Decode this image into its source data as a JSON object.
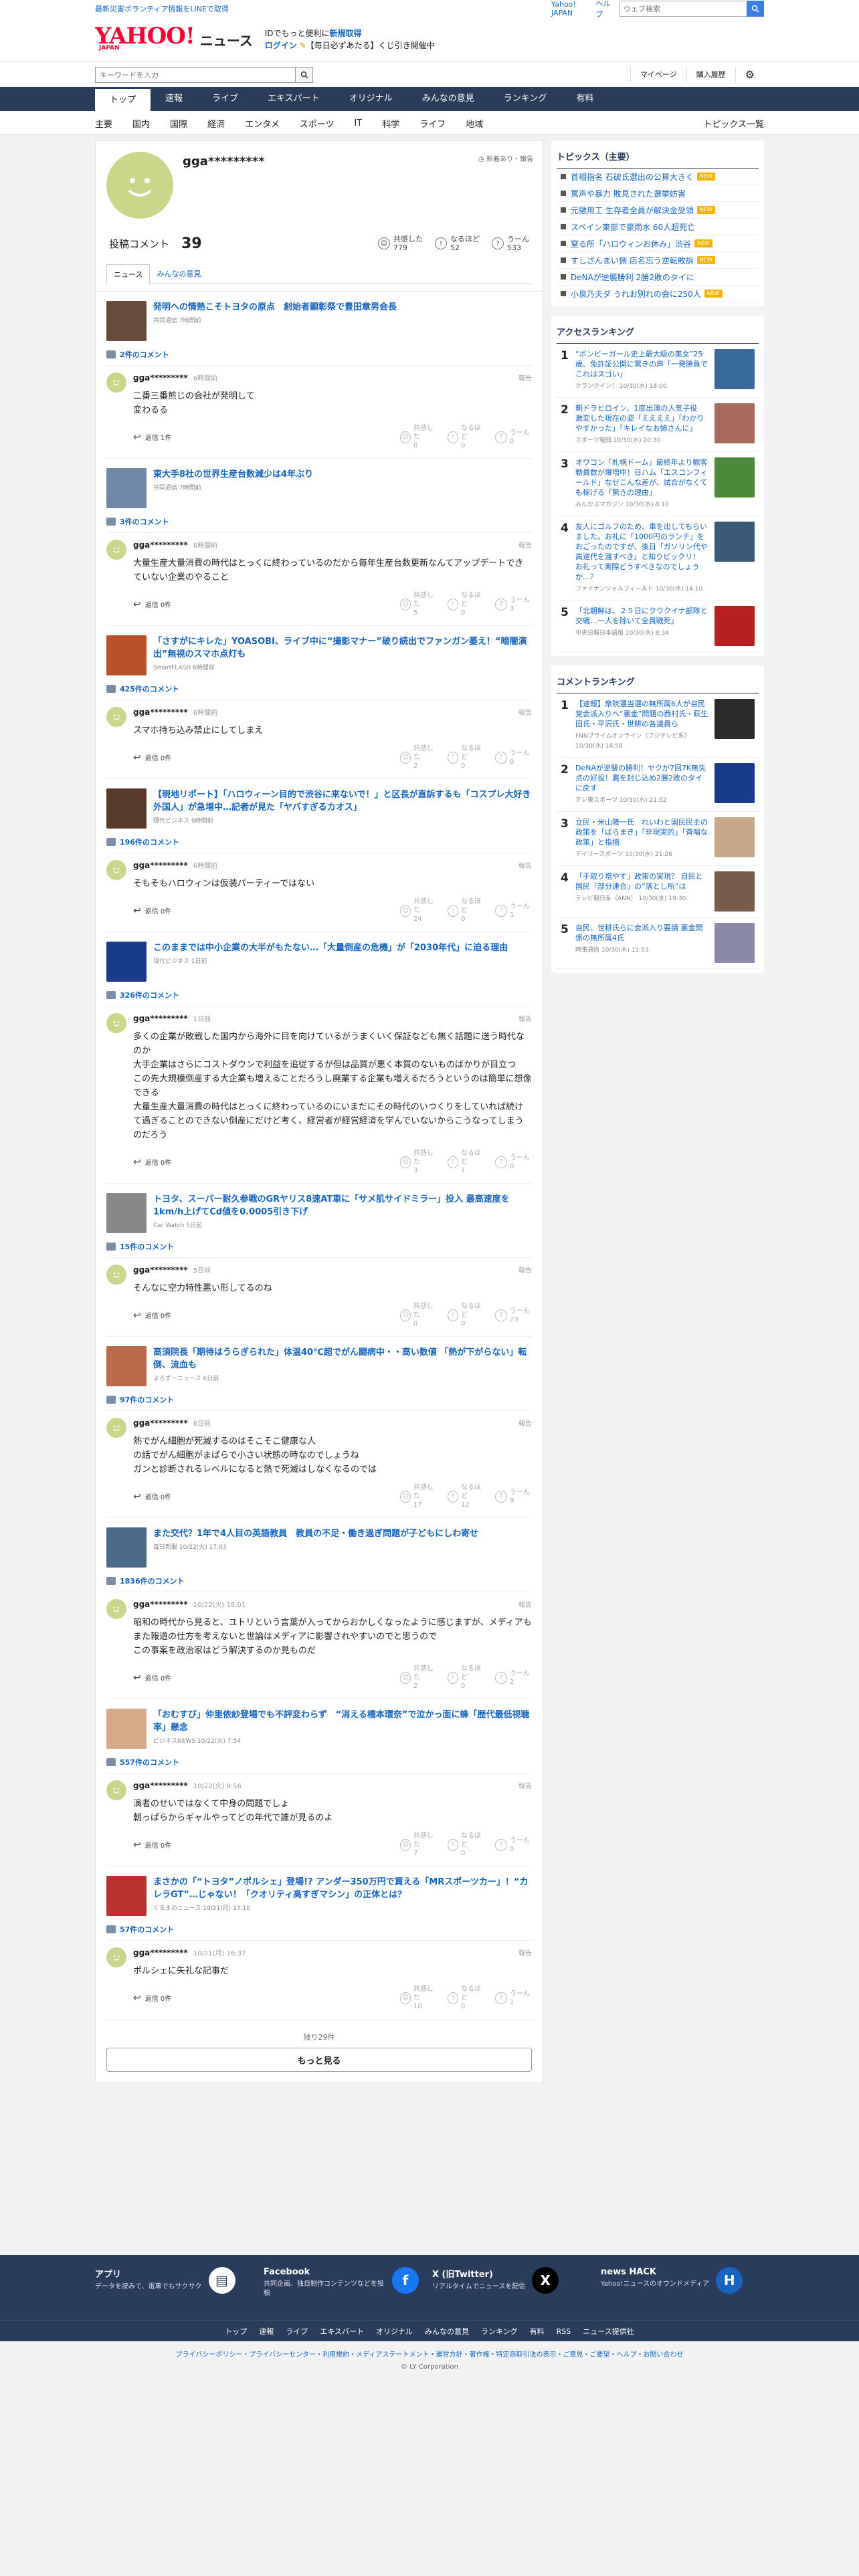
{
  "topline": {
    "notice": "最新災害ボランティア情報をLINEで取得",
    "yahoo_japan": "Yahoo! JAPAN",
    "help": "ヘルプ",
    "web_search_placeholder": "ウェブ検索"
  },
  "header": {
    "logo": "YAHOO!",
    "logo_sub": "JAPAN",
    "site": "ニュース",
    "promo_line1": "IDでもっと便利に",
    "promo_new": "新規取得",
    "promo_login": "ログイン",
    "promo_line2": "【毎日必ずあたる】くじ引き開催中"
  },
  "search": {
    "placeholder": "キーワードを入力",
    "mypage": "マイページ",
    "history": "購入履歴"
  },
  "nav": [
    "トップ",
    "速報",
    "ライブ",
    "エキスパート",
    "オリジナル",
    "みんなの意見",
    "ランキング",
    "有料"
  ],
  "categories": [
    "主要",
    "国内",
    "国際",
    "経済",
    "エンタメ",
    "スポーツ",
    "IT",
    "科学",
    "ライフ",
    "地域"
  ],
  "categories_all": "トピックス一覧",
  "profile": {
    "username": "gga*********",
    "notify": "新着あり・報告",
    "comment_label": "投稿コメント",
    "comment_count": "39",
    "stats": [
      {
        "label": "共感した",
        "value": "779"
      },
      {
        "label": "なるほど",
        "value": "52"
      },
      {
        "label": "うーん",
        "value": "533"
      }
    ],
    "tabs": [
      "ニュース",
      "みんなの意見"
    ]
  },
  "reaction_labels": [
    "共感した",
    "なるほど",
    "うーん"
  ],
  "reply_label": "返信 0件",
  "report_label": "報告",
  "colors": {
    "nav": "#2a3c5c",
    "link": "#1565c0",
    "avatar": "#c9d78a"
  },
  "feed": [
    {
      "title": "発明への情熱こそトヨタの原点　創始者顕彰祭で豊田章男会長",
      "source": "共同通信 7時間前",
      "count": "2件のコメント",
      "user": "gga*********",
      "time": "6時間前",
      "text": "二番三番煎じの会社が発明して\n変わるる",
      "reacts": [
        "0",
        "0",
        "0"
      ],
      "reply": "返信 1件"
    },
    {
      "title": "東大手8社の世界生産台数減少は4年ぶり",
      "source": "共同通信 7時間前",
      "count": "3件のコメント",
      "user": "gga*********",
      "time": "6時間前",
      "text": "大量生産大量消費の時代はとっくに終わっているのだから毎年生産台数更新なんてアップデートできていない企業のやること",
      "reacts": [
        "5",
        "0",
        "3"
      ],
      "reply": "返信 0件"
    },
    {
      "title": "「さすがにキレた」YOASOBI、ライブ中に“撮影マナー”破り続出でファンガン萎え！“暗闇演出”無視のスマホ点灯も",
      "source": "SmartFLASH 6時間前",
      "count": "425件のコメント",
      "user": "gga*********",
      "time": "6時間前",
      "text": "スマホ持ち込み禁止にしてしまえ",
      "reacts": [
        "2",
        "0",
        "0"
      ],
      "reply": "返信 0件"
    },
    {
      "title": "【現地リポート】「ハロウィーン目的で渋谷に来ないで！」と区長が直訴するも「コスプレ大好き外国人」が急増中…記者が見た「ヤバすぎるカオス」",
      "source": "現代ビジネス 6時間前",
      "count": "196件のコメント",
      "user": "gga*********",
      "time": "6時間前",
      "text": "そもそもハロウィンは仮装パーティーではない",
      "reacts": [
        "24",
        "0",
        "1"
      ],
      "reply": "返信 0件"
    },
    {
      "title": "このままでは中小企業の大半がもたない…「大量倒産の危機」が「2030年代」に迫る理由",
      "source": "現代ビジネス 1日前",
      "count": "326件のコメント",
      "user": "gga*********",
      "time": "1日前",
      "text": "多くの企業が敗戦した国内から海外に目を向けているがうまくいく保証なども無く話題に送う時代なのか\n大手企業はさらにコストダウンで利益を追従するが但は品質が悪く本質のないものばかりが目立つ\nこの先大規模倒産する大企業も増えることだろうし廃業する企業も増えるだろうというのは簡単に想像できる\n大量生産大量消費の時代はとっくに終わっているのにいまだにその時代のいつくりをしていれば続けて過ぎることのできない倒産にだけど考く、経営者が経営経済を学んでいないからこうなってしまうのだろう",
      "reacts": [
        "3",
        "1",
        "0"
      ],
      "reply": "返信 0件"
    },
    {
      "title": "トヨタ、スーパー耐久参戦のGRヤリス8速AT車に「サメ肌サイドミラー」投入 最高速度を1km/h上げてCd値を0.0005引き下げ",
      "source": "Car Watch 5日前",
      "count": "15件のコメント",
      "user": "gga*********",
      "time": "5日前",
      "text": "そんなに空力特性悪い形してるのね",
      "reacts": [
        "0",
        "0",
        "23"
      ],
      "reply": "返信 0件"
    },
    {
      "title": "高須院長「期待はうらぎられた」体温40℃超でがん闘病中・・高い数値 「熱が下がらない」転倒、流血も",
      "source": "よろずーニュース 6日前",
      "count": "97件のコメント",
      "user": "gga*********",
      "time": "6日前",
      "text": "熱でがん細胞が死滅するのはそこそこ健康な人\nの話でがん細胞がまばらで小さい状態の時なのでしょうね\nガンと診断されるレベルになると熱で死滅はしなくなるのでは",
      "reacts": [
        "17",
        "12",
        "9"
      ],
      "reply": "返信 0件"
    },
    {
      "title": "また交代？1年で4人目の英語教員　教員の不足・働き過ぎ問題が子どもにしわ寄せ",
      "source": "毎日新聞 10/22(火) 17:03",
      "count": "1836件のコメント",
      "user": "gga*********",
      "time": "10/22(火) 18:01",
      "text": "昭和の時代から見ると、ユトリという言葉が入ってからおかしくなったように感じますが、メディアもまた報道の仕方を考えないと世論はメディアに影響されやすいのでと思うので\nこの事案を政治家はどう解決するのか見ものだ",
      "reacts": [
        "2",
        "0",
        "2"
      ],
      "reply": "返信 0件"
    },
    {
      "title": "「おむすび」仲里依紗登場でも不評変わらず　“消える橋本環奈”で泣かっ面に蜂「歴代最低視聴率」懸念",
      "source": "ビジネスNEWS 10/22(火) 7:54",
      "count": "557件のコメント",
      "user": "gga*********",
      "time": "10/22(火) 9:56",
      "text": "演者のせいではなくて中身の問題でしょ\n朝っぱらからギャルやってどの年代で誰が見るのよ",
      "reacts": [
        "7",
        "0",
        "0"
      ],
      "reply": "返信 0件"
    },
    {
      "title": "まさかの「“トヨタ”ノポルシェ」登場!? アンダー350万円で買える「MRスポーツカー」！“カレラGT”…じゃない！「クオリティ高すぎマシン」の正体とは？",
      "source": "くるまのニュース 10/21(月) 17:10",
      "count": "57件のコメント",
      "user": "gga*********",
      "time": "10/21(月) 16:37",
      "text": "ポルシェに失礼な記事だ",
      "reacts": [
        "10",
        "0",
        "1"
      ],
      "reply": "返信 0件"
    }
  ],
  "feed_remaining": "残り29件",
  "more_button": "もっと見る",
  "sidebar": {
    "topics_title": "トピックス（主要）",
    "topics": [
      {
        "text": "首相指名 石破氏選出の公算大きく",
        "badge": "NEW"
      },
      {
        "text": "罵声や暴力 敗見された選挙妨害",
        "badge": ""
      },
      {
        "text": "元徴用工 生存者全員が解決金受領",
        "badge": "NEW"
      },
      {
        "text": "スペイン東部で豪雨水 60人超死亡",
        "badge": ""
      },
      {
        "text": "窒る所「ハロウィンお休み」渋谷",
        "badge": "NEW"
      },
      {
        "text": "すしざんまい側 店名忘う逆転敗訴",
        "badge": "NEW"
      },
      {
        "text": "DeNAが逆襲勝利 2勝2敗のタイに",
        "badge": ""
      },
      {
        "text": "小泉乃夫ダ うれお別れの会に250人",
        "badge": "NEW"
      }
    ],
    "access_title": "アクセスランキング",
    "access": [
      {
        "rank": "1",
        "text": "“ボンビーガール史上最大級の美女”25歳、免許証公開に驚きの声「一発勝負でこれはスゴい」",
        "src": "クランクイン！ 10/30(水) 18:00"
      },
      {
        "rank": "2",
        "text": "朝ドラヒロイン、1度出演の人気子役　激変した現在の姿「ええええ」「わかりやすかった」「キレイなお姉さんに」",
        "src": "スポーツ報知 10/30(水) 20:30"
      },
      {
        "rank": "3",
        "text": "オワコン「札幌ドーム」最終年より観客動員数が爆増中！日ハム「エスコンフィールド」なぜこんな差が、試合がなくても稼げる「驚きの理由」",
        "src": "みんかぶマガジン 10/30(水) 8:10"
      },
      {
        "rank": "4",
        "text": "友人にゴルフのため、車を出してもらいました。お礼に「1000円のランチ」をおごったのですが、後日「ガソリン代や高速代を渡すべき」と知りビックリ！ お礼って実際どうすべきなのでしょうか…？",
        "src": "ファイナンシャルフィールド 10/30(水) 14:10"
      },
      {
        "rank": "5",
        "text": "「北朝鮮は、２５日にクウクイナ部隊と交戦…一人を除いて全員戦死」",
        "src": "中央日報日本語版 10/30(水) 8:34"
      }
    ],
    "comment_title": "コメントランキング",
    "comment": [
      {
        "rank": "1",
        "text": "【速報】衆院選当選の無所属6人が自民党会派入りへ“裏金”問題の西村氏・萩生田氏・平沢氏・世耕の各議員ら",
        "src": "FNNプライムオンライン（フジテレビ系） 10/30(水) 16:58"
      },
      {
        "rank": "2",
        "text": "DeNAが逆襲の勝利！ヤクが7回7K無失点の好投！鷹を封じ込め2勝2敗のタイに戻す",
        "src": "テレ東スポーツ 10/30(水) 21:52"
      },
      {
        "rank": "3",
        "text": "立民・米山隆一氏　れいわと国民民主の政策を「ばらまき」「非現実的」「斉唱な政策」と指摘",
        "src": "デイリースポーツ 10/30(水) 21:26"
      },
      {
        "rank": "4",
        "text": "「手取り増やす」政策の実現？ 自民と国民「部分連合」の“落とし所”は",
        "src": "テレビ朝日系（ANN） 10/30(水) 19:30"
      },
      {
        "rank": "5",
        "text": "自民、世耕氏らに会派入り要請 裏金関係の無所属4氏",
        "src": "時事通信 10/30(水) 11:53"
      }
    ]
  },
  "footer": {
    "apps": [
      {
        "title": "アプリ",
        "desc": "データを読みて、電車でもサクサク"
      },
      {
        "title": "Facebook",
        "desc": "共同企画、独自制作コンテンツなどを投稿"
      },
      {
        "title": "X (旧Twitter)",
        "desc": "リアルタイムでニュースを配信"
      },
      {
        "title": "news HACK",
        "desc": "Yahoo!ニュースのオウンドメディア"
      }
    ],
    "links": [
      "トップ",
      "速報",
      "ライブ",
      "エキスパート",
      "オリジナル",
      "みんなの意見",
      "ランキング",
      "有料",
      "RSS",
      "ニュース提供社"
    ],
    "legal": "プライバシーポリシー・プライバシーセンター・利用規約・メディアステートメント・運営方針・著作権・特定商取引法の表示・ご意見・ご要望・ヘルプ・お問い合わせ",
    "copyright": "© LY Corporation"
  }
}
